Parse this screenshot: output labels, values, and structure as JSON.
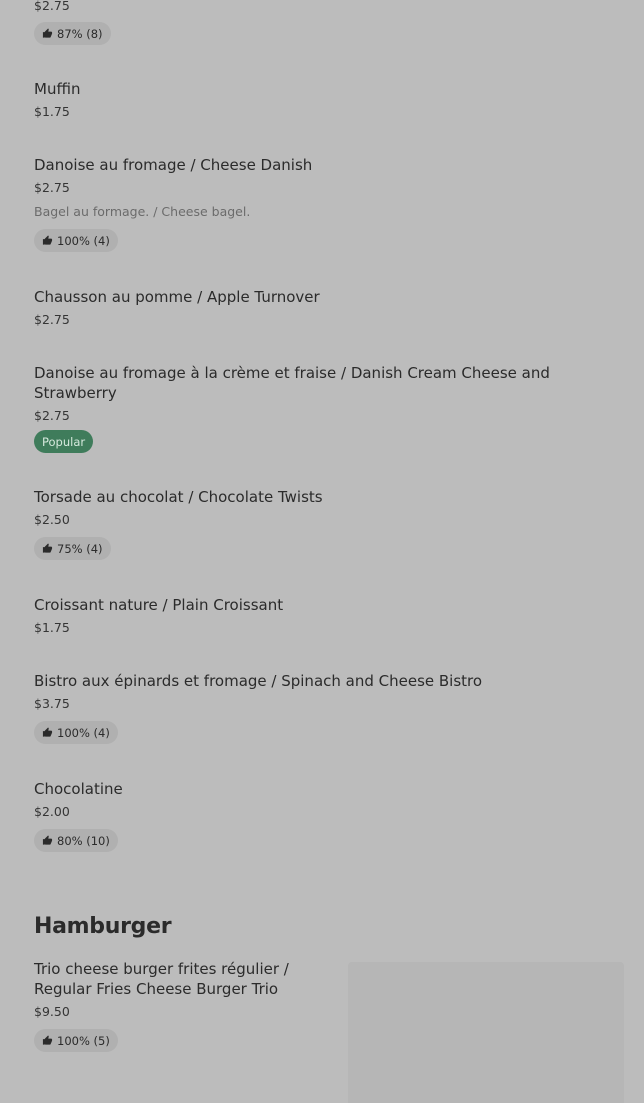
{
  "top_item": {
    "price": "$2.75",
    "rating": "87% (8)"
  },
  "items": [
    {
      "name": "Muffin",
      "price": "$1.75"
    },
    {
      "name": "Danoise au fromage / Cheese Danish",
      "price": "$2.75",
      "description": "Bagel au formage. / Cheese bagel.",
      "rating": "100% (4)"
    },
    {
      "name": "Chausson au pomme / Apple Turnover",
      "price": "$2.75"
    },
    {
      "name": "Danoise au fromage à la crème et fraise / Danish Cream Cheese and Strawberry",
      "price": "$2.75",
      "badge": "Popular"
    },
    {
      "name": "Torsade au chocolat / Chocolate Twists",
      "price": "$2.50",
      "rating": "75% (4)"
    },
    {
      "name": "Croissant nature / Plain Croissant",
      "price": "$1.75"
    },
    {
      "name": "Bistro aux épinards et fromage / Spinach and Cheese Bistro",
      "price": "$3.75",
      "rating": "100% (4)"
    },
    {
      "name": "Chocolatine",
      "price": "$2.00",
      "rating": "80% (10)"
    }
  ],
  "section": {
    "title": "Hamburger",
    "items": [
      {
        "name": "Trio cheese burger frites régulier / Regular Fries Cheese Burger Trio",
        "price": "$9.50",
        "rating": "100% (5)"
      }
    ]
  },
  "icons": {
    "rating": "thumbs-up-icon"
  },
  "colors": {
    "background": "#bcbcbc",
    "popular_badge": "#3f7c5b",
    "rating_pill": "#b0b0b0"
  }
}
